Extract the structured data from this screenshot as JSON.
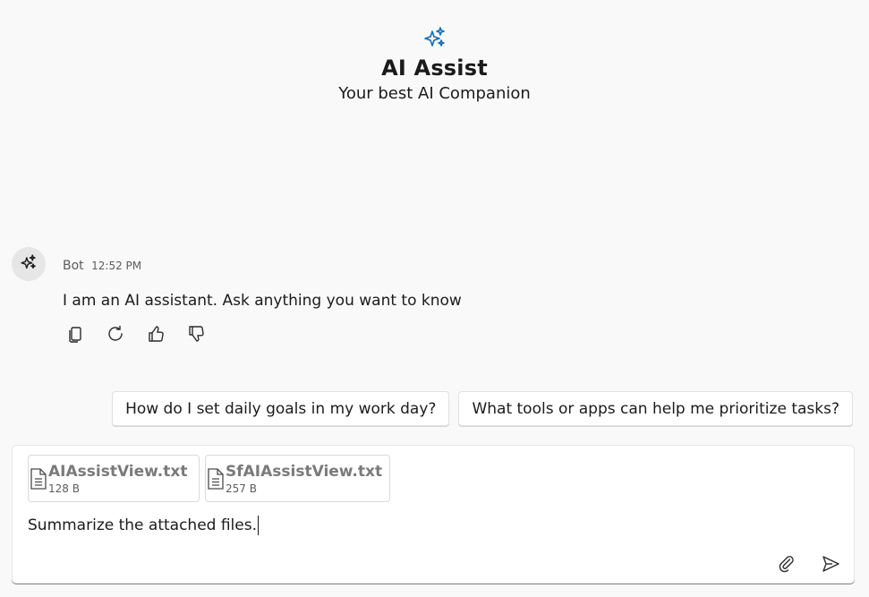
{
  "header": {
    "icon": "sparkle-icon",
    "title": "AI Assist",
    "subtitle": "Your best AI Companion"
  },
  "conversation": {
    "bot": {
      "avatar_icon": "sparkle-icon",
      "name": "Bot",
      "time": "12:52 PM",
      "message": "I am an AI assistant. Ask anything you want to know",
      "actions": [
        "copy-icon",
        "refresh-icon",
        "thumbs-up-icon",
        "thumbs-down-icon"
      ]
    }
  },
  "suggestions": [
    "How do I set daily goals in my work day?",
    "What tools or apps can help me prioritize tasks?"
  ],
  "composer": {
    "attachments": [
      {
        "name": "AIAssistView.txt",
        "size": "128 B",
        "icon": "document-icon"
      },
      {
        "name": "SfAIAssistView.txt",
        "size": "257 B",
        "icon": "document-icon"
      }
    ],
    "input_value": "Summarize the attached files.",
    "attach_icon": "paperclip-icon",
    "send_icon": "send-icon"
  },
  "colors": {
    "accent": "#0f6cbd",
    "background": "#f9f9f9",
    "surface": "#ffffff"
  }
}
